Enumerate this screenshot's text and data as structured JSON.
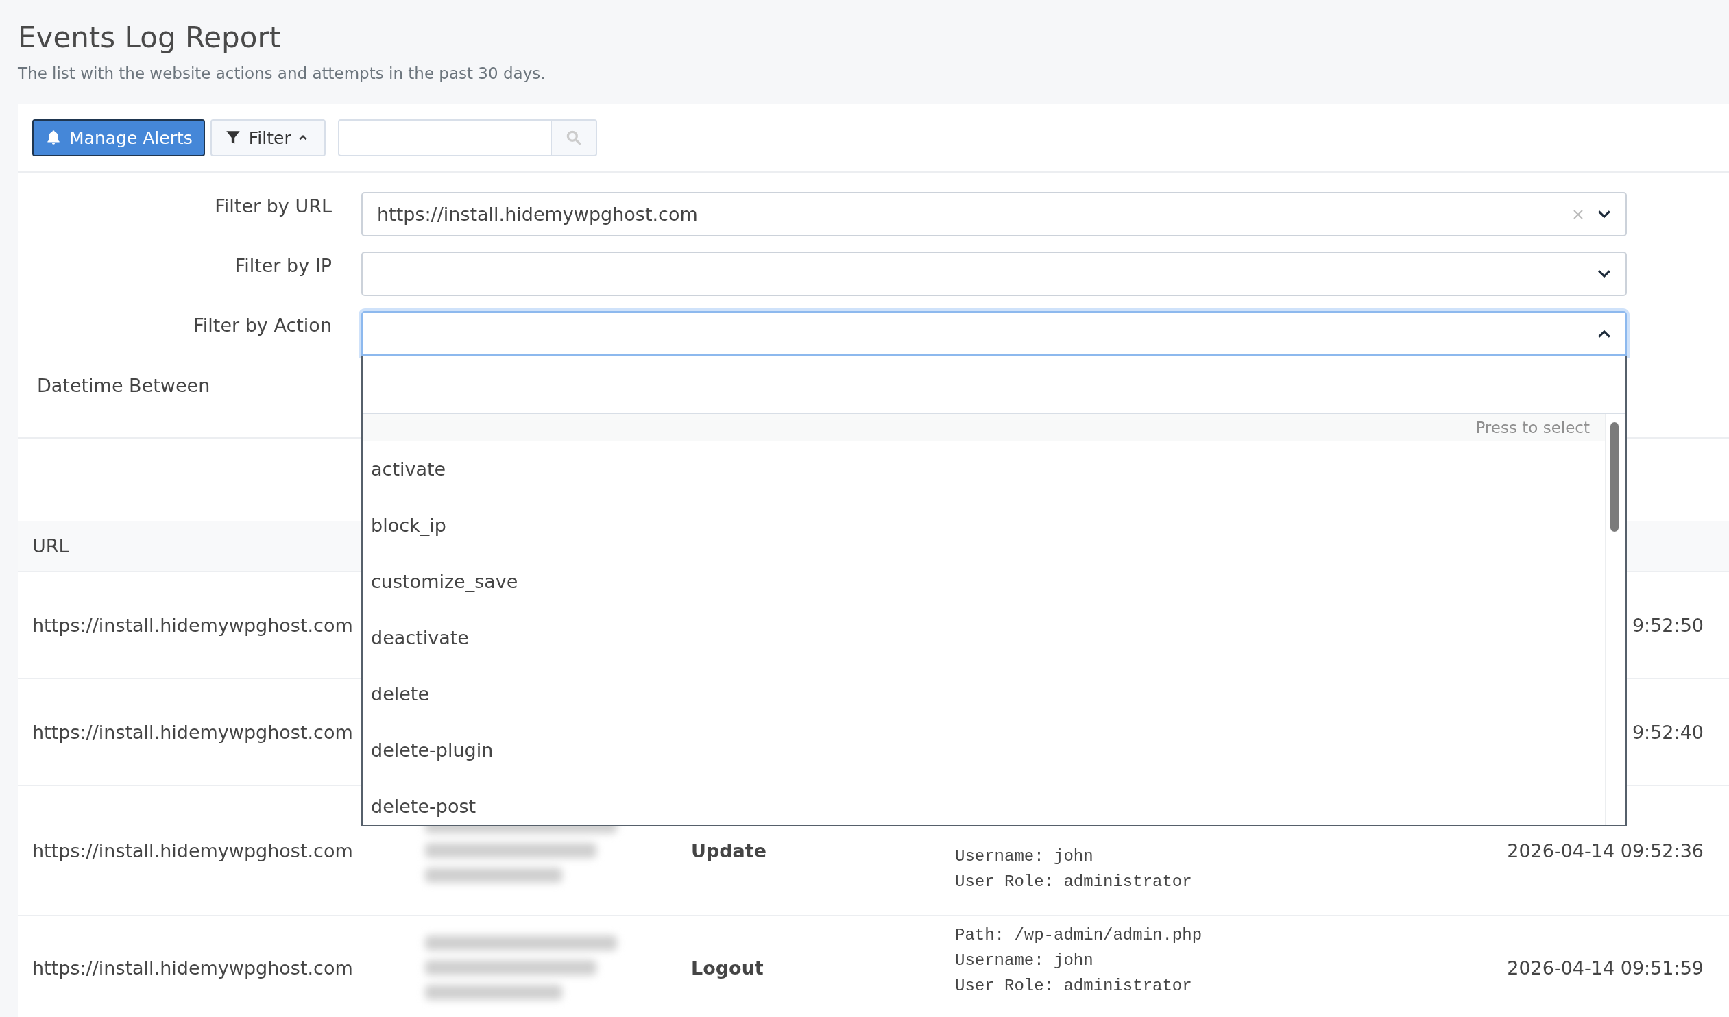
{
  "page": {
    "title": "Events Log Report",
    "subtitle": "The list with the website actions and attempts in the past 30 days."
  },
  "toolbar": {
    "manage_alerts": "Manage Alerts",
    "filter": "Filter",
    "filter_expanded": true
  },
  "filters": [
    {
      "label": "Filter by URL",
      "value": "https://install.hidemywpghost.com",
      "clearable": true,
      "open": false
    },
    {
      "label": "Filter by IP",
      "clearable": false,
      "open": false
    },
    {
      "label": "Filter by Action",
      "clearable": false,
      "open": true
    }
  ],
  "datetime_label": "Datetime Between",
  "dropdown": {
    "hint": "Press to select",
    "options": [
      "activate",
      "block_ip",
      "customize_save",
      "deactivate",
      "delete",
      "delete-plugin",
      "delete-post"
    ]
  },
  "table": {
    "columns": [
      "URL"
    ],
    "rows": [
      {
        "url": "https://install.hidemywpghost.com",
        "datetime": "9:52:50"
      },
      {
        "url": "https://install.hidemywpghost.com",
        "datetime": "9:52:40"
      },
      {
        "url": "https://install.hidemywpghost.com",
        "action": "Update",
        "details": [
          "Username: john",
          "User Role: administrator"
        ],
        "datetime": "2026-04-14 09:52:36"
      },
      {
        "url": "https://install.hidemywpghost.com",
        "action": "Logout",
        "details": [
          "Path: /wp-admin/admin.php",
          "Username: john",
          "User Role: administrator"
        ],
        "datetime": "2026-04-14 09:51:59"
      }
    ]
  }
}
